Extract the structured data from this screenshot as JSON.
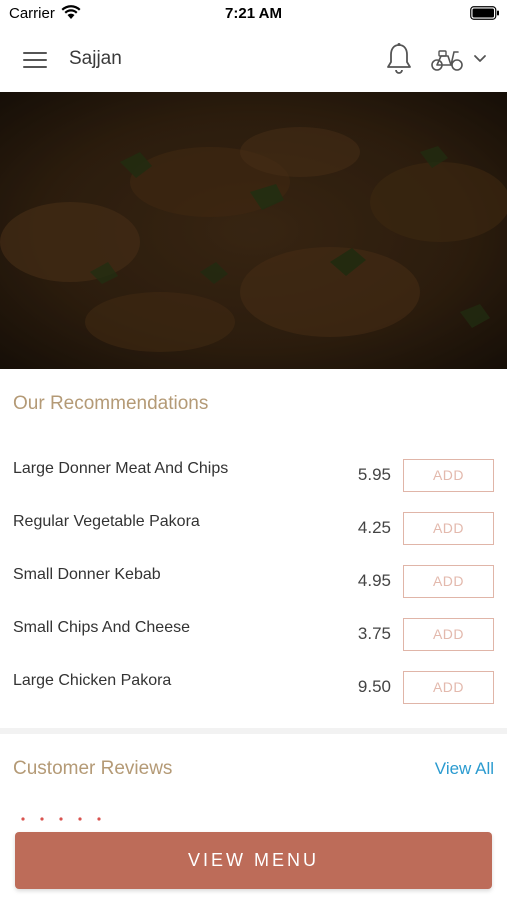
{
  "status_bar": {
    "carrier": "Carrier",
    "time": "7:21 AM"
  },
  "header": {
    "title": "Sajjan",
    "icons": [
      "menu-icon",
      "bell-icon",
      "scooter-icon",
      "chevron-down-icon"
    ]
  },
  "recommendations": {
    "title": "Our Recommendations",
    "add_label": "ADD",
    "items": [
      {
        "name": "Large Donner Meat And Chips",
        "price": "5.95"
      },
      {
        "name": "Regular Vegetable Pakora",
        "price": "4.25"
      },
      {
        "name": "Small Donner Kebab",
        "price": "4.95"
      },
      {
        "name": "Small Chips And Cheese",
        "price": "3.75"
      },
      {
        "name": "Large Chicken Pakora",
        "price": "9.50"
      }
    ]
  },
  "reviews": {
    "title": "Customer Reviews",
    "view_all": "View All"
  },
  "cta": {
    "label": "VIEW MENU"
  },
  "colors": {
    "accent_gold": "#b49a76",
    "cta_background": "#bd6c59",
    "add_button_border": "#e0b5a8",
    "link_blue": "#2b9bd0",
    "star_red": "#d9534f"
  }
}
